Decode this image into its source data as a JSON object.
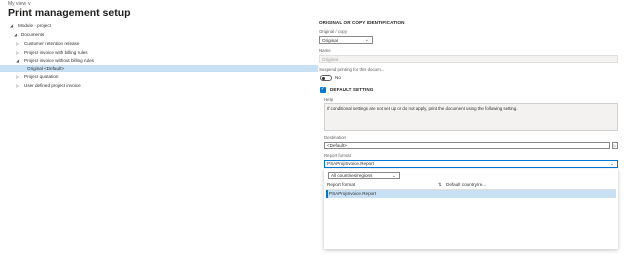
{
  "header": {
    "view_label": "My view ∨",
    "title": "Print management setup"
  },
  "tree": [
    {
      "label": "Module - project",
      "expanded": true,
      "level": 0
    },
    {
      "label": "Documents",
      "expanded": true,
      "level": 1
    },
    {
      "label": "Customer retention release",
      "expanded": false,
      "level": 2
    },
    {
      "label": "Project invoice with billing rules",
      "expanded": false,
      "level": 2
    },
    {
      "label": "Project invoice without billing rules",
      "expanded": true,
      "level": 2
    },
    {
      "label": "Original <Default>",
      "selected": true,
      "level": 3
    },
    {
      "label": "Project quotation",
      "expanded": false,
      "level": 2
    },
    {
      "label": "User defined project invoice",
      "expanded": false,
      "level": 2
    }
  ],
  "panel": {
    "section_title": "ORIGINAL OR COPY IDENTIFICATION",
    "orig_copy_label": "Original / copy",
    "orig_copy_value": "Original",
    "name_label": "Name",
    "name_value": "Original",
    "suspend_label": "Suspend printing for this docum...",
    "suspend_value": "No",
    "default_setting_label": "DEFAULT SETTING",
    "help_label": "Help",
    "help_text": "If conditional settings are not set up or do not apply, print the document using the following setting.",
    "destination_label": "Destination",
    "destination_value": "<Default>",
    "report_format_label": "Report format",
    "report_format_value": "PSAProjInvoice.Report",
    "country_filter": "All countries/regions",
    "grid_headers": [
      "Report format",
      "Default country/re..."
    ],
    "grid_rows": [
      [
        "PSAProjInvoice.Report",
        ""
      ]
    ]
  }
}
